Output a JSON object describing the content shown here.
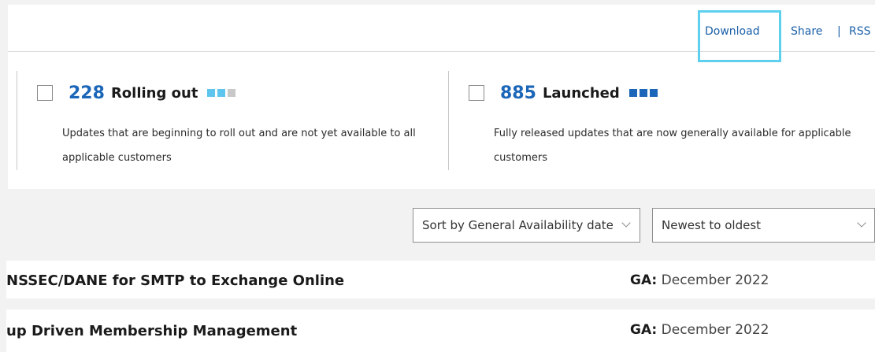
{
  "top_links": {
    "download": "Download",
    "share": "Share",
    "rss": "RSS",
    "separator": "|"
  },
  "status_cards": [
    {
      "count": "228",
      "label": "Rolling out",
      "description": "Updates that are beginning to roll out and are not yet available to all applicable customers",
      "pip_colors": [
        "#5ec5ee",
        "#5ec5ee",
        "#c8c8c8"
      ]
    },
    {
      "count": "885",
      "label": "Launched",
      "description": "Fully released updates that are now generally available for applicable customers",
      "pip_colors": [
        "#1b66b8",
        "#1b66b8",
        "#1b66b8"
      ]
    }
  ],
  "sort": {
    "sort_by": "Sort by General Availability date",
    "order": "Newest to oldest"
  },
  "rows": [
    {
      "title": "NSSEC/DANE for SMTP to Exchange Online",
      "ga_key": "GA:",
      "ga_value": "December 2022"
    },
    {
      "title": "up Driven Membership Management",
      "ga_key": "GA:",
      "ga_value": "December 2022"
    }
  ],
  "colors": {
    "accent": "#1b66b8",
    "link": "#1a5fa8",
    "focus": "#5ed0ee",
    "background": "#f2f2f2"
  }
}
